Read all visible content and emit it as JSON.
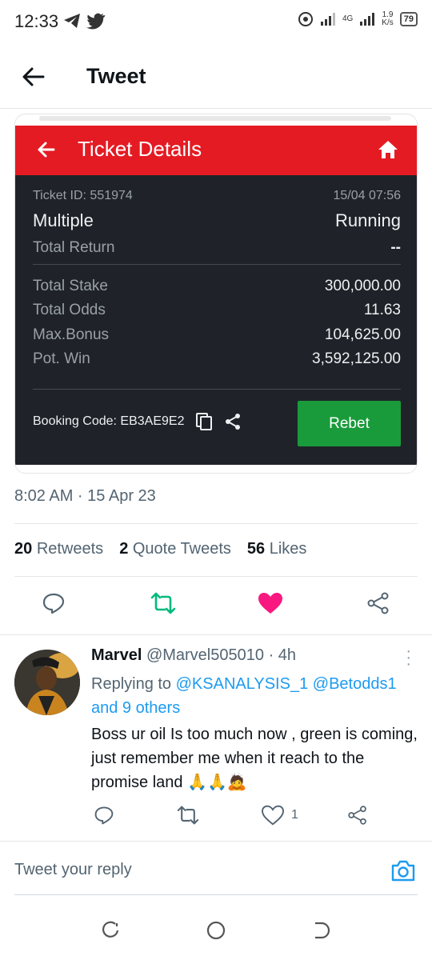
{
  "status_bar": {
    "time": "12:33",
    "network_type": "4G",
    "speed": "1.9",
    "speed_unit": "K/s",
    "battery": "79"
  },
  "header": {
    "title": "Tweet"
  },
  "ticket": {
    "title": "Ticket Details",
    "ticket_id_label": "Ticket ID: 551974",
    "date": "15/04 07:56",
    "type": "Multiple",
    "status": "Running",
    "total_return_label": "Total Return",
    "total_return_value": "--",
    "rows": [
      {
        "label": "Total Stake",
        "value": "300,000.00"
      },
      {
        "label": "Total Odds",
        "value": "11.63"
      },
      {
        "label": "Max.Bonus",
        "value": "104,625.00"
      },
      {
        "label": "Pot. Win",
        "value": "3,592,125.00"
      }
    ],
    "booking_code": "Booking Code: EB3AE9E2",
    "rebet_label": "Rebet",
    "colors": {
      "header": "#e41b23",
      "body": "#1f2329",
      "button": "#1a9b3b"
    }
  },
  "tweet": {
    "timestamp": "8:02 AM · 15 Apr 23",
    "retweets_count": "20",
    "retweets_label": "Retweets",
    "quotes_count": "2",
    "quotes_label": "Quote Tweets",
    "likes_count": "56",
    "likes_label": "Likes"
  },
  "reply": {
    "name": "Marvel",
    "handle": "@Marvel505010",
    "time": "· 4h",
    "replying_to_label": "Replying to",
    "mention_1": "@KSANALYSIS_1",
    "mention_2": "@Betodds1",
    "others": "and 9 others",
    "text": "Boss ur oil Is too much now , green is coming, just remember me when it reach to the promise land 🙏🙏🙇",
    "like_count": "1"
  },
  "compose": {
    "placeholder": "Tweet your reply"
  },
  "colors": {
    "link": "#1d9bf0",
    "retweet": "#00ba7c",
    "like": "#f91880"
  }
}
